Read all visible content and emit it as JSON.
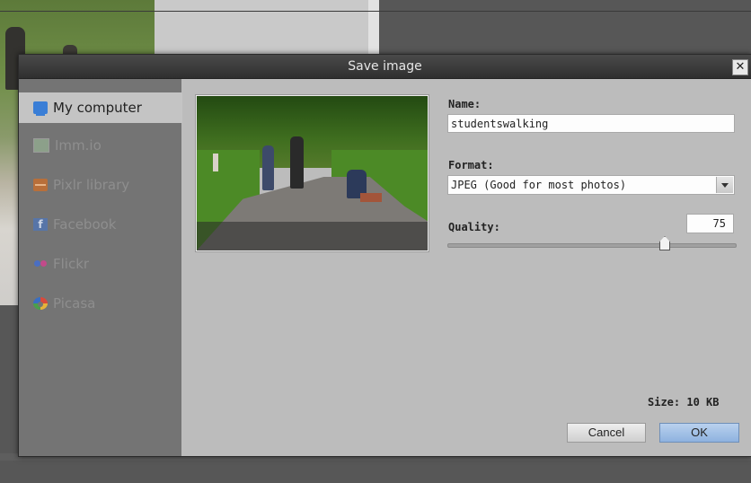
{
  "dialog": {
    "title": "Save image",
    "close_label": "✕"
  },
  "sidebar": {
    "items": [
      {
        "label": "My computer",
        "icon": "computer-icon",
        "active": true
      },
      {
        "label": "Imm.io",
        "icon": "image-icon",
        "active": false
      },
      {
        "label": "Pixlr library",
        "icon": "library-icon",
        "active": false
      },
      {
        "label": "Facebook",
        "icon": "facebook-icon",
        "active": false,
        "glyph": "f"
      },
      {
        "label": "Flickr",
        "icon": "flickr-icon",
        "active": false
      },
      {
        "label": "Picasa",
        "icon": "picasa-icon",
        "active": false
      }
    ]
  },
  "form": {
    "name_label": "Name:",
    "name_value": "studentswalking",
    "format_label": "Format:",
    "format_value": "JPEG (Good for most photos)",
    "quality_label": "Quality:",
    "quality_value": "75",
    "quality_fraction": 0.75,
    "size_text": "Size: 10 KB"
  },
  "buttons": {
    "cancel": "Cancel",
    "ok": "OK"
  },
  "colors": {
    "accent": "#8eb2df",
    "dialog_bg": "#bcbcbc",
    "sidebar_bg": "#747474",
    "titlebar": "#2f2f2f"
  }
}
